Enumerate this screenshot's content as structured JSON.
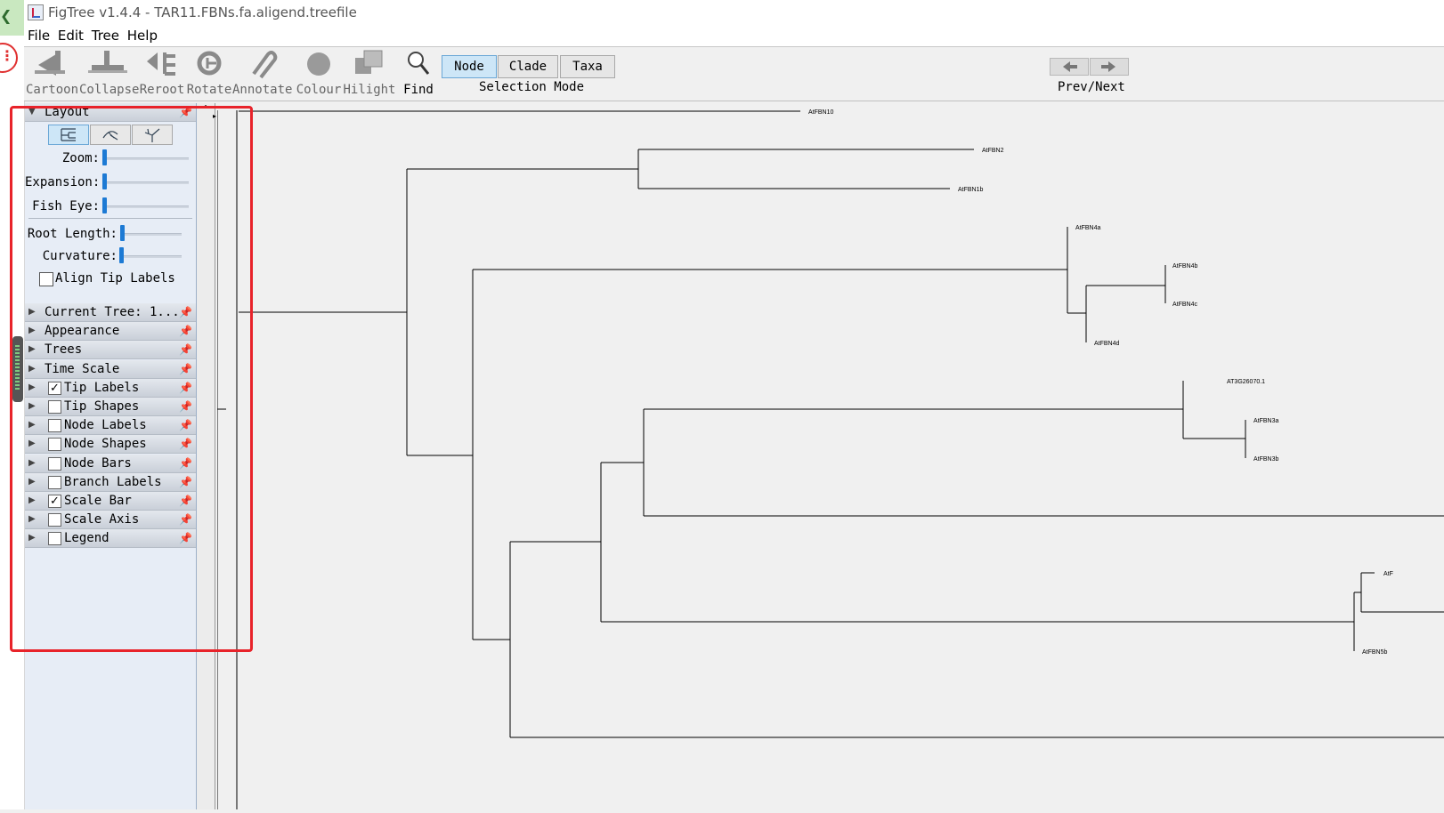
{
  "window": {
    "title": "FigTree v1.4.4 - TAR11.FBNs.fa.aligend.treefile"
  },
  "menu": [
    "File",
    "Edit",
    "Tree",
    "Help"
  ],
  "toolbar": {
    "tools": [
      "Cartoon",
      "Collapse",
      "Reroot",
      "Rotate",
      "Annotate",
      "Colour",
      "Hilight",
      "Find"
    ],
    "selection_modes": [
      "Node",
      "Clade",
      "Taxa"
    ],
    "selection_mode_label": "Selection Mode",
    "selected_mode": "Node",
    "prevnext_label": "Prev/Next"
  },
  "panel": {
    "layout": {
      "header": "Layout",
      "zoom_label": "Zoom:",
      "expansion_label": "Expansion:",
      "fisheye_label": "Fish Eye:",
      "rootlength_label": "Root Length:",
      "curvature_label": "Curvature:",
      "align_label": "Align Tip Labels",
      "align_checked": false,
      "zoom": 0,
      "expansion": 0,
      "fisheye": 0,
      "rootlength": 0,
      "curvature": 0
    },
    "sections": [
      {
        "label": "Current Tree: 1...",
        "has_checkbox": false
      },
      {
        "label": "Appearance",
        "has_checkbox": false
      },
      {
        "label": "Trees",
        "has_checkbox": false
      },
      {
        "label": "Time Scale",
        "has_checkbox": false
      },
      {
        "label": "Tip Labels",
        "has_checkbox": true,
        "checked": true
      },
      {
        "label": "Tip Shapes",
        "has_checkbox": true,
        "checked": false
      },
      {
        "label": "Node Labels",
        "has_checkbox": true,
        "checked": false
      },
      {
        "label": "Node Shapes",
        "has_checkbox": true,
        "checked": false
      },
      {
        "label": "Node Bars",
        "has_checkbox": true,
        "checked": false
      },
      {
        "label": "Branch Labels",
        "has_checkbox": true,
        "checked": false
      },
      {
        "label": "Scale Bar",
        "has_checkbox": true,
        "checked": true
      },
      {
        "label": "Scale Axis",
        "has_checkbox": true,
        "checked": false
      },
      {
        "label": "Legend",
        "has_checkbox": true,
        "checked": false
      }
    ]
  },
  "tree": {
    "tips": [
      "AtFBN10",
      "AtFBN2",
      "AtFBN1b",
      "AtFBN4a",
      "AtFBN4b",
      "AtFBN4c",
      "AtFBN4d",
      "AT3G26070.1",
      "AtFBN3a",
      "AtFBN3b",
      "AtF",
      "AtFBN5b"
    ]
  },
  "colors": {
    "highlight_box": "#e8232a",
    "accent": "#1d7ad4",
    "selected": "#cde6f7"
  }
}
